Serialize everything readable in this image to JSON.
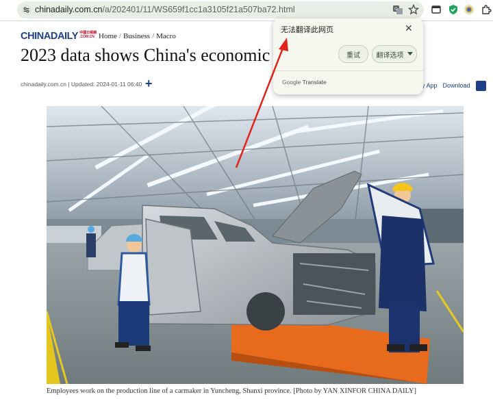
{
  "browser": {
    "url_host": "chinadaily.com.cn",
    "url_path": "/a/202401/11/WS659f1cc1a3105f21a507ba72.html"
  },
  "translate_popup": {
    "message": "无法翻译此网页",
    "retry_label": "重试",
    "options_label": "翻译选项",
    "close_label": "✕",
    "brand_google": "Google",
    "brand_translate": "Translate"
  },
  "site": {
    "logo_main": "CHINADAILY",
    "logo_sub": "中國日報網",
    "logo_domain": ".COM.CN",
    "breadcrumb": [
      "Home",
      "Business",
      "Macro"
    ],
    "breadcrumb_sep": "/"
  },
  "article": {
    "headline": "2023 data shows China's economic r",
    "source": "chinadaily.com.cn",
    "meta_sep": "|",
    "updated": "Updated: 2024-01-11 06:40",
    "share_symbol": "+",
    "app_label": "ily App",
    "download_label": "Download",
    "caption": "Employees work on the production line of a carmaker in Yuncheng, Shanxi province. [Photo by YAN XINFOR CHINA DAILY]"
  },
  "colors": {
    "brand_blue": "#1d3f87",
    "annotation_red": "#e0241b",
    "toolbar_bg": "#ffffff",
    "omnibox_bg": "#e8ede5"
  },
  "icons": {
    "site_info": "tune-icon",
    "translate": "translate-icon",
    "bookmark": "star-icon",
    "tab_search": "tab-icon",
    "shield": "shield-extension-icon",
    "profile": "profile-avatar-icon",
    "extensions": "puzzle-icon"
  }
}
